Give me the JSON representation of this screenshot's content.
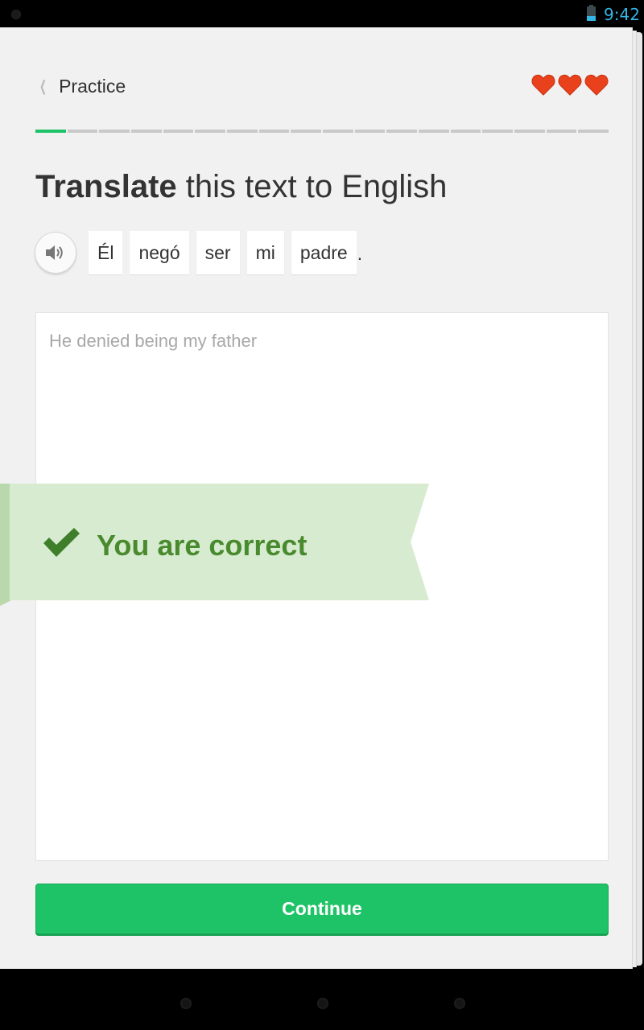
{
  "status_bar": {
    "time": "9:42",
    "battery_icon": "battery-icon"
  },
  "header": {
    "back_label": "Practice",
    "back_icon": "chevron-left-icon",
    "hearts_count": 3,
    "heart_color": "#e8411c"
  },
  "progress": {
    "segments": 18,
    "completed": 1,
    "accent": "#1fc367"
  },
  "prompt": {
    "title_bold": "Translate",
    "title_rest": " this text to English",
    "speaker_icon": "speaker-icon",
    "words": [
      "Él",
      "negó",
      "ser",
      "mi",
      "padre"
    ],
    "punctuation": "."
  },
  "answer": {
    "text": "He denied being my father"
  },
  "feedback": {
    "message": "You are correct",
    "icon": "checkmark-icon",
    "color": "#4a8a2e",
    "background": "#d7ebd0"
  },
  "actions": {
    "continue_label": "Continue"
  }
}
